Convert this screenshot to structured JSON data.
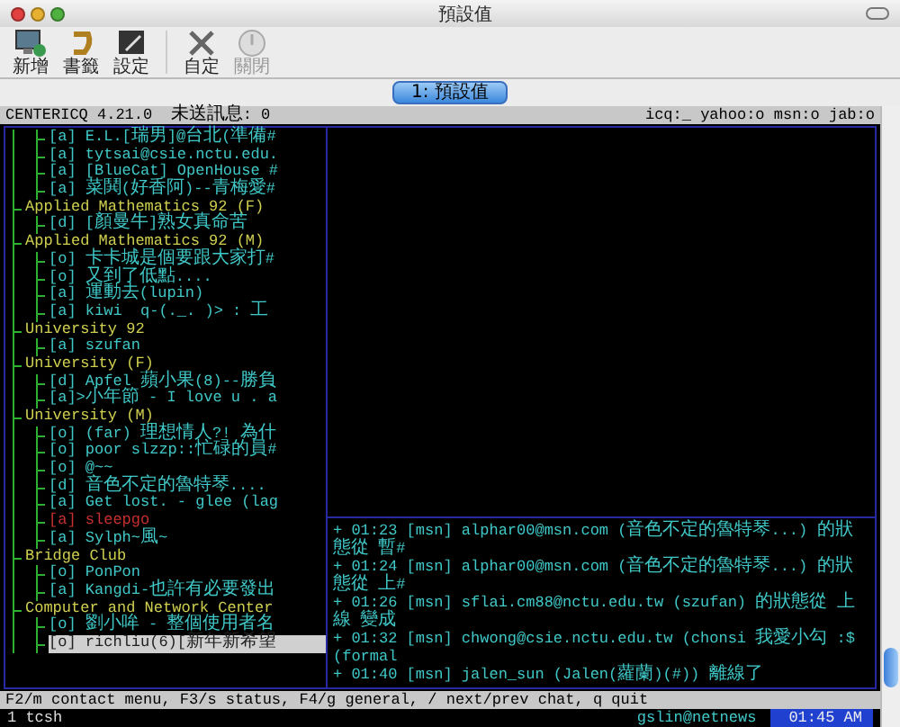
{
  "window": {
    "title": "預設值"
  },
  "toolbar": {
    "groups": [
      [
        {
          "kind": "new",
          "label": "新增",
          "disabled": false
        },
        {
          "kind": "bookmark",
          "label": "書籤",
          "disabled": false
        },
        {
          "kind": "settings",
          "label": "設定",
          "disabled": false
        }
      ],
      [
        {
          "kind": "customize",
          "label": "自定",
          "disabled": false
        },
        {
          "kind": "close",
          "label": "關閉",
          "disabled": true
        }
      ]
    ]
  },
  "tabs": [
    {
      "label": "1: 預設值",
      "selected": true
    }
  ],
  "terminal": {
    "header": {
      "title": "CENTERICQ 4.21.0",
      "unsent": "未送訊息: 0",
      "protocols": "icq:_ yahoo:o msn:o jab:o"
    },
    "contacts": [
      {
        "children": [
          {
            "text": "[a] E.L.[瑞男]@台北(準備#",
            "color": "#40c8c8",
            "selected": false
          },
          {
            "text": "[a] tytsai@csie.nctu.edu.",
            "color": "#40c8c8",
            "selected": false
          },
          {
            "text": "[a] [BlueCat] OpenHouse #",
            "color": "#40c8c8",
            "selected": false
          },
          {
            "text": "[a] 菜鬨(好香阿)--青梅愛#",
            "color": "#40c8c8",
            "selected": false
          }
        ]
      },
      {
        "name": "Applied Mathematics 92 (F)",
        "children": [
          {
            "text": "[d] [顏曼牛]熟女真命苦",
            "color": "#40c8c8",
            "selected": false
          }
        ]
      },
      {
        "name": "Applied Mathematics 92 (M)",
        "children": [
          {
            "text": "[o] 卡卡城是個要跟大家打#",
            "color": "#40c8c8",
            "selected": false
          },
          {
            "text": "[o] 又到了低點....",
            "color": "#40c8c8",
            "selected": false
          },
          {
            "text": "[a] 運動去(lupin)",
            "color": "#40c8c8",
            "selected": false
          },
          {
            "text": "[a] kiwi  q-(._. )> : 工",
            "color": "#40c8c8",
            "selected": false
          }
        ]
      },
      {
        "name": "University 92",
        "children": [
          {
            "text": "[a] szufan",
            "color": "#40c8c8",
            "selected": false
          }
        ]
      },
      {
        "name": "University (F)",
        "children": [
          {
            "text": "[d] Apfel 蘋小果(8)--勝負",
            "color": "#40c8c8",
            "selected": false
          },
          {
            "text": "[a]>小年節 - I love u . a",
            "color": "#40c8c8",
            "selected": false
          }
        ]
      },
      {
        "name": "University (M)",
        "children": [
          {
            "text": "[o] (far) 理想情人?! 為什",
            "color": "#40c8c8",
            "selected": false
          },
          {
            "text": "[o] poor slzzp::忙碌的員#",
            "color": "#40c8c8",
            "selected": false
          },
          {
            "text": "[o] @~~",
            "color": "#40c8c8",
            "selected": false
          },
          {
            "text": "[d] 音色不定的魯特琴....",
            "color": "#40c8c8",
            "selected": false
          },
          {
            "text": "[a] Get lost. - glee (lag",
            "color": "#40c8c8",
            "selected": false
          },
          {
            "text": "[a] sleepgo",
            "color": "#c83030",
            "selected": false
          },
          {
            "text": "[a] Sylph~風~",
            "color": "#40c8c8",
            "selected": false
          }
        ]
      },
      {
        "name": "Bridge Club",
        "children": [
          {
            "text": "[o] PonPon",
            "color": "#40c8c8",
            "selected": false
          },
          {
            "text": "[a] Kangdi-也許有必要發出",
            "color": "#40c8c8",
            "selected": false
          }
        ]
      },
      {
        "name": "Computer and Network Center",
        "children": [
          {
            "text": "[o] 劉小哞 - 整個使用者名",
            "color": "#40c8c8",
            "selected": false
          },
          {
            "text": "[o] richliu(6)[新年新希望",
            "color": "#202020",
            "selected": true
          }
        ]
      }
    ],
    "log": [
      "+ 01:23 [msn] alphar00@msn.com (音色不定的魯特琴...) 的狀態從 暫#",
      "+ 01:24 [msn] alphar00@msn.com (音色不定的魯特琴...) 的狀態從 上#",
      "+ 01:26 [msn] sflai.cm88@nctu.edu.tw (szufan) 的狀態從 上線 變成",
      "+ 01:32 [msn] chwong@csie.nctu.edu.tw (chonsi 我愛小勾 :$ (formal",
      "+ 01:40 [msn] jalen_sun (Jalen(蘿蘭)(#)) 離線了"
    ],
    "help": "F2/m contact menu, F3/s status, F4/g general, / next/prev chat, q quit",
    "shell": {
      "window": "1 tcsh",
      "host": "gslin@netnews",
      "clock": "01:45 AM"
    }
  }
}
